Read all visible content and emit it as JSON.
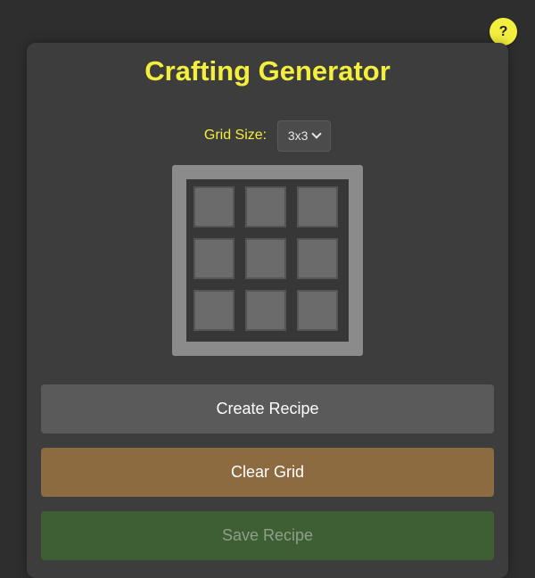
{
  "help": {
    "label": "?"
  },
  "app": {
    "title": "Crafting Generator"
  },
  "grid_size": {
    "label": "Grid Size:",
    "selected": "3x3"
  },
  "crafting_grid": {
    "rows": 3,
    "cols": 3
  },
  "buttons": {
    "create": "Create Recipe",
    "clear": "Clear Grid",
    "save": "Save Recipe"
  },
  "colors": {
    "accent": "#f4ef3e",
    "background": "#2e2e2e",
    "panel": "#3d3d3d",
    "create_button": "#5a5a5a",
    "clear_button": "#8c6b40",
    "save_button": "#3d5f33"
  },
  "icons": {
    "help": "question-mark-icon",
    "dropdown": "chevron-down-icon"
  }
}
